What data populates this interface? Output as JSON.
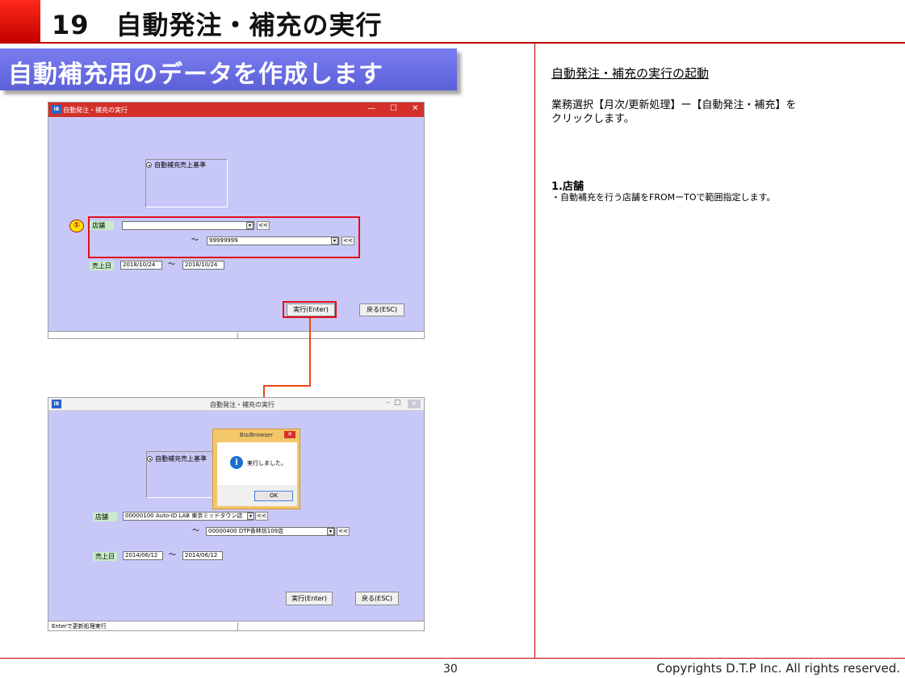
{
  "header": {
    "title": "19　自動発注・補充の実行"
  },
  "banner": {
    "text": "自動補充用のデータを作成します"
  },
  "right_panel": {
    "heading": "自動発注・補充の実行の起動",
    "paragraph": "業務選択【月次/更新処理】ー【自動発注・補充】を\nクリックします。",
    "step_title": "1.店舗",
    "step_desc": "・自動補充を行う店舗をFROMーTOで範囲指定します。"
  },
  "window1": {
    "app_icon": "iB",
    "title": "自動発注・補充の実行",
    "controls": {
      "min": "—",
      "max": "☐",
      "close": "✕"
    },
    "radio_label": "自動補充売上基準",
    "store_label": "店舗",
    "store_from": "",
    "store_to": "99999999",
    "dropdown_glyph": "▾",
    "search_glyph": "<<",
    "tilde": "〜",
    "date_label": "売上日",
    "date_from": "2018/10/24",
    "date_to": "2018/10/24",
    "execute_button": "実行(Enter)",
    "back_button": "戻る(ESC)",
    "badge": "①"
  },
  "window2": {
    "app_icon": "iB",
    "title": "自動発注・補充の実行",
    "controls": {
      "min": "–",
      "max": "□",
      "close": "✕"
    },
    "radio_label": "自動補充売上基準",
    "store_label": "店舗",
    "store_from": "00000100 Auto-ID LAB 東京ミッドタウン店",
    "store_to": "00000400 DTP香林坊109店",
    "dropdown_glyph": "▾",
    "search_glyph": "<<",
    "tilde": "〜",
    "date_label": "売上日",
    "date_from": "2014/06/12",
    "date_to": "2014/06/12",
    "execute_button": "実行(Enter)",
    "back_button": "戻る(ESC)",
    "status_text": "Enterで更新処理実行"
  },
  "dialog": {
    "title": "Biz/Browser",
    "close": "✕",
    "info_glyph": "i",
    "message": "実行しました。",
    "ok_button": "OK"
  },
  "footer": {
    "page_number": "30",
    "copyright": "Copyrights  D.T.P Inc. All rights reserved."
  },
  "colors": {
    "accent_red": "#c00000",
    "banner_blue": "#6366e0",
    "window_bg": "#c8c8f8",
    "highlight": "#e0101a"
  }
}
